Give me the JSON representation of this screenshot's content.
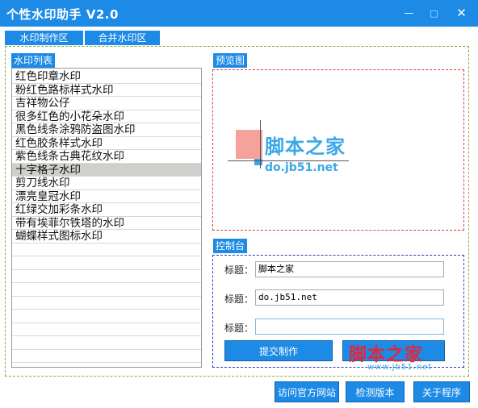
{
  "window": {
    "title": "个性水印助手 V2.0",
    "minimize_glyph": "—",
    "maximize_glyph": "□",
    "close_glyph": "✕"
  },
  "tabs": [
    {
      "label": "水印制作区",
      "active": true
    },
    {
      "label": "合并水印区",
      "active": false
    }
  ],
  "list_panel": {
    "label": "水印列表",
    "items": [
      "红色印章水印",
      "粉红色路标样式水印",
      "吉祥物公仔",
      "很多红色的小花朵水印",
      "黑色线条涂鸦防盗图水印",
      "红色胶条样式水印",
      "紫色线条古典花纹水印",
      "十字格子水印",
      "剪刀线水印",
      "漂亮皇冠水印",
      "红绿交加彩条水印",
      "带有埃菲尔铁塔的水印",
      "蝴蝶样式图标水印"
    ],
    "selected_index": 7
  },
  "preview": {
    "label": "预览图",
    "text_main": "脚本之家",
    "text_sub": "do.jb51.net"
  },
  "control": {
    "label": "控制台",
    "fields": [
      {
        "label": "标题：",
        "value": "脚本之家"
      },
      {
        "label": "标题：",
        "value": "do.jb51.net"
      },
      {
        "label": "标题：",
        "value": ""
      }
    ],
    "submit_label": "提交制作",
    "watermark_main": "脚本之家",
    "watermark_sub": "www.jb51.net"
  },
  "footer_buttons": {
    "visit": "访问官方网站",
    "check": "检测版本",
    "about": "关于程序"
  },
  "colors": {
    "accent": "#1d8ae6",
    "selected_row": "#d1cfcc",
    "preview_border": "#d94040",
    "control_border": "#2a3fbf",
    "outer_border": "#8fa83a",
    "watermark_block": "#f5a39a",
    "watermark_text": "#3aa8e8",
    "watermark_red": "#e0283a"
  }
}
